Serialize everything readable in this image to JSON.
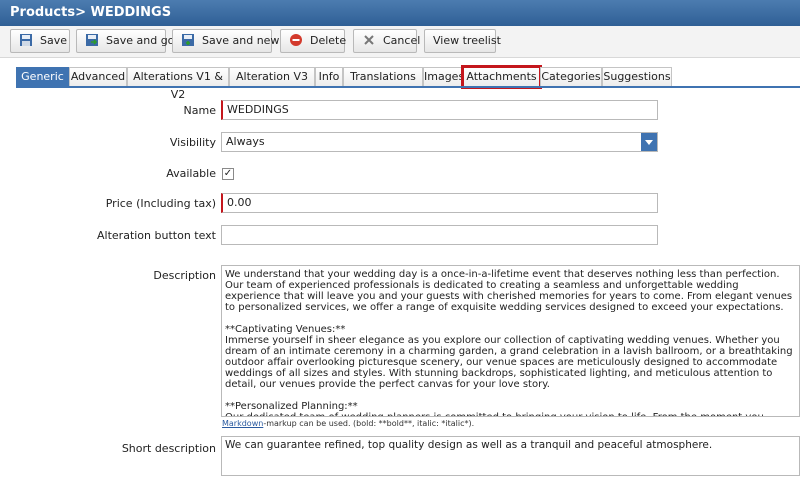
{
  "window": {
    "title": "Products> WEDDINGS"
  },
  "toolbar": {
    "save": "Save",
    "save_go": "Save and go",
    "save_new": "Save and new",
    "delete": "Delete",
    "cancel": "Cancel",
    "view_treelist": "View treelist"
  },
  "tabs": [
    {
      "label": "Generic"
    },
    {
      "label": "Advanced"
    },
    {
      "label": "Alterations V1 & V2"
    },
    {
      "label": "Alteration V3"
    },
    {
      "label": "Info"
    },
    {
      "label": "Translations"
    },
    {
      "label": "Images"
    },
    {
      "label": "Attachments"
    },
    {
      "label": "Categories"
    },
    {
      "label": "Suggestions"
    }
  ],
  "active_tab": "Generic",
  "form": {
    "name_label": "Name",
    "name_value": "WEDDINGS",
    "visibility_label": "Visibility",
    "visibility_value": "Always",
    "available_label": "Available",
    "available_check": "✓",
    "price_label": "Price (Including tax)",
    "price_value": "0.00",
    "alteration_label": "Alteration button text",
    "alteration_value": "",
    "description_label": "Description",
    "description_value": "We understand that your wedding day is a once-in-a-lifetime event that deserves nothing less than perfection. Our team of experienced professionals is dedicated to creating a seamless and unforgettable wedding experience that will leave you and your guests with cherished memories for years to come. From elegant venues to personalized services, we offer a range of exquisite wedding services designed to exceed your expectations.\n\n**Captivating Venues:**\nImmerse yourself in sheer elegance as you explore our collection of captivating wedding venues. Whether you dream of an intimate ceremony in a charming garden, a grand celebration in a lavish ballroom, or a breathtaking outdoor affair overlooking picturesque scenery, our venue spaces are meticulously designed to accommodate weddings of all sizes and styles. With stunning backdrops, sophisticated lighting, and meticulous attention to detail, our venues provide the perfect canvas for your love story.\n\n**Personalized Planning:**\nOur dedicated team of wedding planners is committed to bringing your vision to life. From the moment you choose our hotel as your wedding venue, our expert planners will guide you through every step of the planning process. We understand that each couple is unique, and we take pride in crafting personalized experiences that reflect your individual style and preferences. From conceptualizing the overall theme to coordinating with vendors and ensuring flawless execution on your special day, we are here to turn your dreams into reality.",
    "markdown_link": "Markdown",
    "markdown_hint": "-markup can be used. (bold: **bold**, italic: *italic*).",
    "short_description_label": "Short description",
    "short_description_value": "We can guarantee refined, top quality design as well as a tranquil and peaceful atmosphere."
  },
  "icons": {
    "save": "floppy-disk-icon",
    "save_go": "floppy-arrow-icon",
    "save_new": "floppy-plus-icon",
    "delete": "delete-circle-icon",
    "cancel": "x-icon",
    "select": "chevron-down-icon"
  },
  "colors": {
    "accent": "#3f73b1",
    "title_bar": "#3a6aa2",
    "required": "#c4161c",
    "highlight": "#c4161c"
  }
}
